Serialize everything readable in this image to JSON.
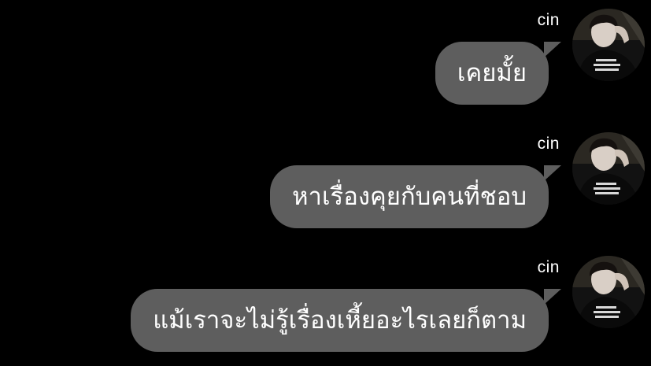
{
  "messages": [
    {
      "sender": "cin",
      "text": "เคยมั้ย"
    },
    {
      "sender": "cin",
      "text": "หาเรื่องคุยกับคนที่ชอบ"
    },
    {
      "sender": "cin",
      "text": "แม้เราจะไม่รู้เรื่องเหี้ยอะไรเลยก็ตาม"
    }
  ],
  "colors": {
    "background": "#000000",
    "bubble": "#5e5e5e",
    "text": "#ffffff"
  }
}
